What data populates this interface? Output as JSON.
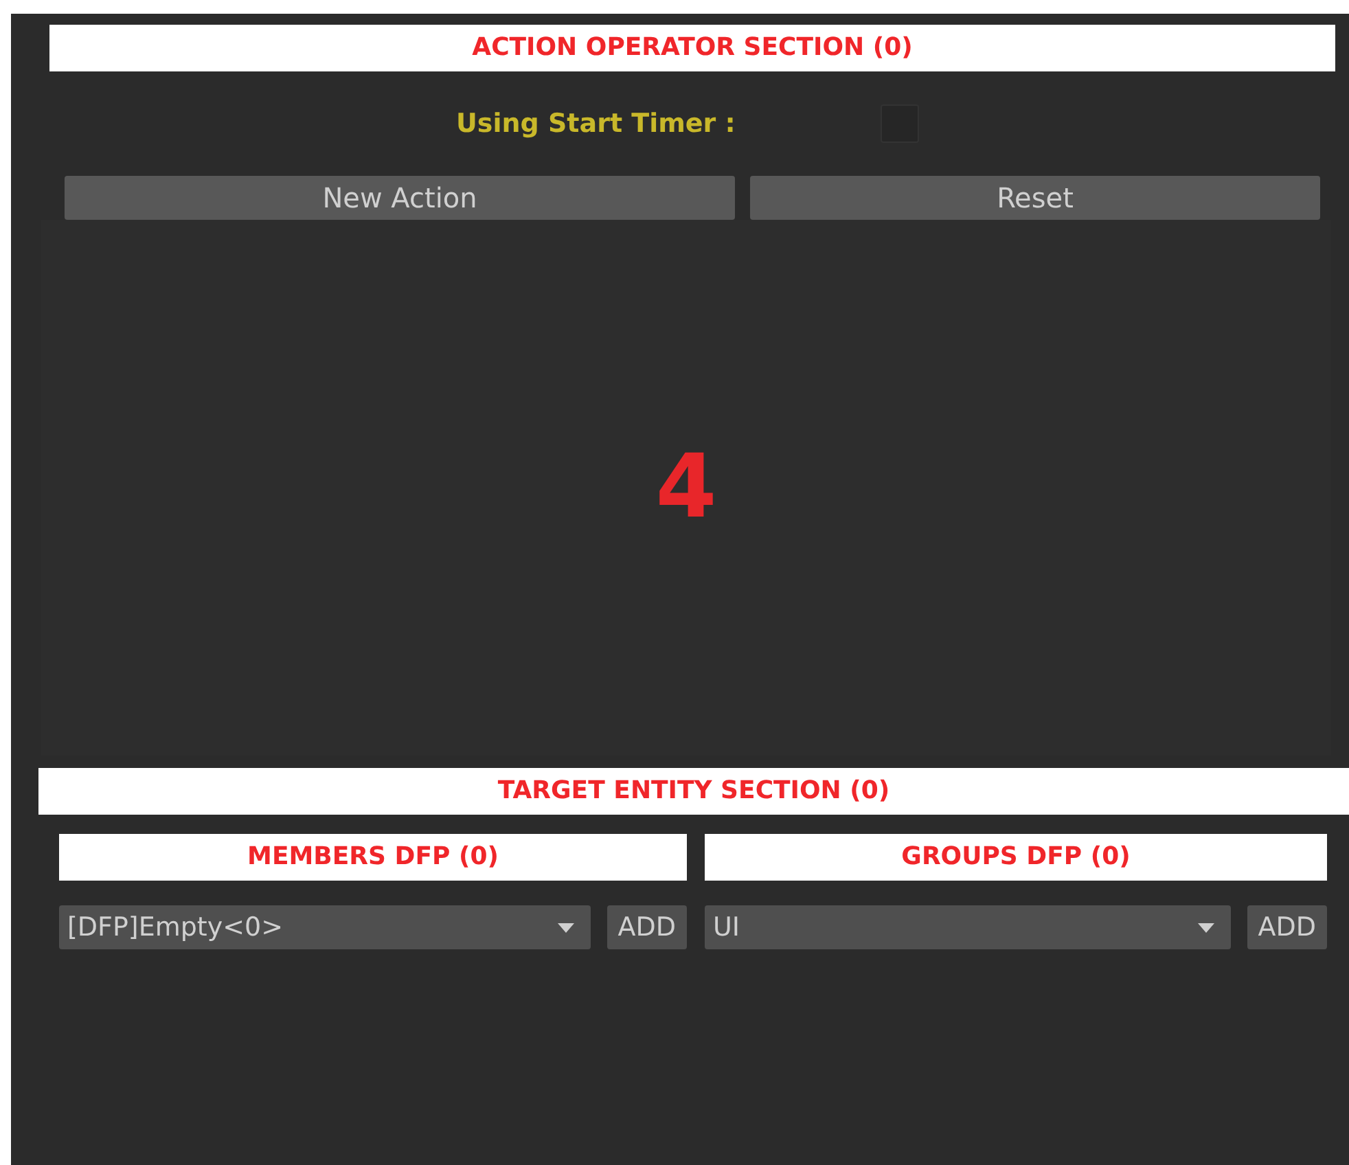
{
  "action_section": {
    "title": "ACTION OPERATOR SECTION (0)",
    "timer_label": "Using Start Timer :",
    "timer_checked": false,
    "buttons": [
      "New Action",
      "Reset"
    ],
    "marker": "4"
  },
  "target_section": {
    "title": "TARGET ENTITY SECTION (0)",
    "columns": [
      {
        "title": "MEMBERS DFP (0)",
        "dropdown": "[DFP]Empty<0>",
        "button": "ADD"
      },
      {
        "title": "GROUPS DFP (0)",
        "dropdown": "UI",
        "button": "ADD"
      }
    ]
  }
}
